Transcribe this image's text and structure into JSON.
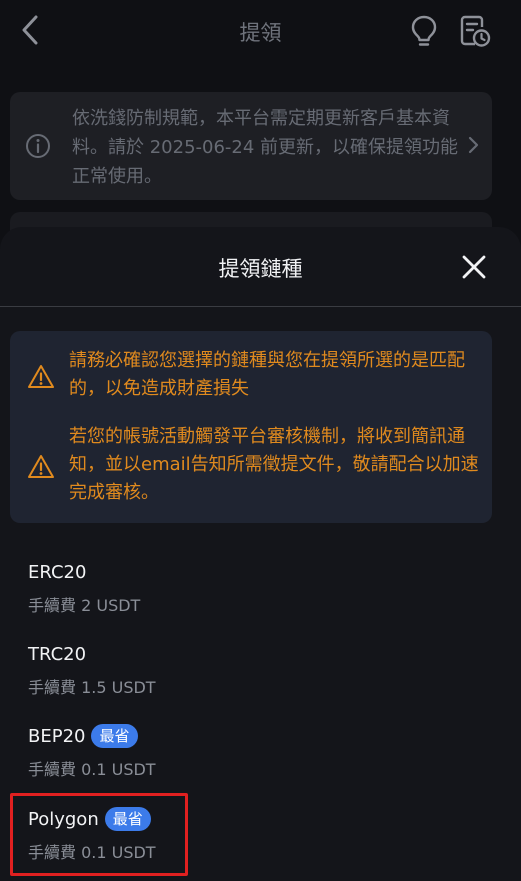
{
  "header": {
    "title": "提領"
  },
  "notice": {
    "text": "依洗錢防制規範，本平台需定期更新客戶基本資料。請於 2025-06-24 前更新，以確保提領功能正常使用。"
  },
  "sheet": {
    "title": "提領鏈種",
    "warnings": [
      {
        "text": "請務必確認您選擇的鏈種與您在提領所選的是匹配的，以免造成財產損失"
      },
      {
        "text": "若您的帳號活動觸發平台審核機制，將收到簡訊通知，並以email告知所需徵提文件，敬請配合以加速完成審核。"
      }
    ],
    "chains": [
      {
        "name": "ERC20",
        "fee": "手續費 2 USDT",
        "badge": ""
      },
      {
        "name": "TRC20",
        "fee": "手續費 1.5 USDT",
        "badge": ""
      },
      {
        "name": "BEP20",
        "fee": "手續費 0.1 USDT",
        "badge": "最省"
      },
      {
        "name": "Polygon",
        "fee": "手續費 0.1 USDT",
        "badge": "最省"
      }
    ]
  },
  "colors": {
    "background": "#0f1014",
    "sheet": "#14151a",
    "warning_text": "#e08a1e",
    "badge": "#3c7bea",
    "highlight": "#e02020"
  },
  "icons": [
    "back-arrow-icon",
    "lightbulb-icon",
    "history-icon",
    "info-icon",
    "chevron-right-icon",
    "close-icon",
    "warning-icon"
  ]
}
